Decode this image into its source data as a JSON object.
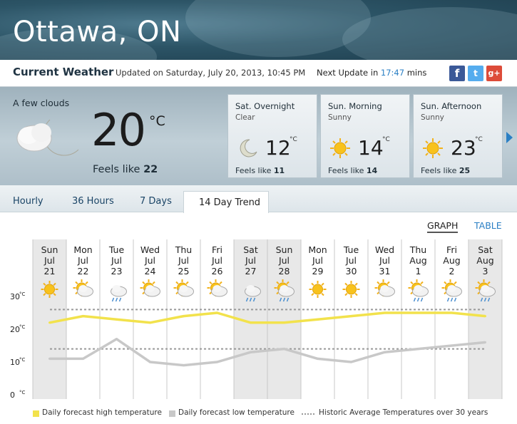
{
  "header": {
    "city": "Ottawa, ON"
  },
  "status": {
    "current_weather_label": "Current Weather",
    "updated": "Updated on Saturday, July 20, 2013, 10:45 PM",
    "next_update_prefix": "Next Update in",
    "next_update_value": "17:47",
    "next_update_suffix": "mins",
    "social": [
      {
        "name": "facebook-icon",
        "glyph": "f"
      },
      {
        "name": "twitter-icon",
        "glyph": "t"
      },
      {
        "name": "google-plus-icon",
        "glyph": "g+"
      }
    ]
  },
  "current": {
    "condition": "A few clouds",
    "temp": "20",
    "unit": "°C",
    "feels_prefix": "Feels like",
    "feels_value": "22",
    "icon": "cloud-moon-icon"
  },
  "forecast": [
    {
      "title": "Sat. Overnight",
      "desc": "Clear",
      "temp": "12",
      "unit": "°C",
      "feels_prefix": "Feels like",
      "feels": "11",
      "icon": "moon-icon"
    },
    {
      "title": "Sun. Morning",
      "desc": "Sunny",
      "temp": "14",
      "unit": "°C",
      "feels_prefix": "Feels like",
      "feels": "14",
      "icon": "sun-icon"
    },
    {
      "title": "Sun. Afternoon",
      "desc": "Sunny",
      "temp": "23",
      "unit": "°C",
      "feels_prefix": "Feels like",
      "feels": "25",
      "icon": "sun-icon"
    }
  ],
  "tabs": [
    "Hourly",
    "36 Hours",
    "7 Days",
    "14 Day Trend"
  ],
  "active_tab": "14 Day Trend",
  "view_toggle": {
    "graph": "GRAPH",
    "table": "TABLE",
    "active": "GRAPH"
  },
  "chart_data": {
    "type": "line",
    "x": [
      "Sun Jul 21",
      "Mon Jul 22",
      "Tue Jul 23",
      "Wed Jul 24",
      "Thu Jul 25",
      "Fri Jul 26",
      "Sat Jul 27",
      "Sun Jul 28",
      "Mon Jul 29",
      "Tue Jul 30",
      "Wed Jul 31",
      "Thu Aug 1",
      "Fri Aug 2",
      "Sat Aug 3"
    ],
    "days": [
      {
        "d": "Sun",
        "m": "Jul",
        "n": "21",
        "icon": "sun-icon",
        "weekend": true
      },
      {
        "d": "Mon",
        "m": "Jul",
        "n": "22",
        "icon": "sun-cloud-icon",
        "weekend": false
      },
      {
        "d": "Tue",
        "m": "Jul",
        "n": "23",
        "icon": "rain-cloud-icon",
        "weekend": false
      },
      {
        "d": "Wed",
        "m": "Jul",
        "n": "24",
        "icon": "sun-cloud-icon",
        "weekend": false
      },
      {
        "d": "Thu",
        "m": "Jul",
        "n": "25",
        "icon": "sun-cloud-icon",
        "weekend": false
      },
      {
        "d": "Fri",
        "m": "Jul",
        "n": "26",
        "icon": "sun-cloud-icon",
        "weekend": false
      },
      {
        "d": "Sat",
        "m": "Jul",
        "n": "27",
        "icon": "rain-cloud-icon",
        "weekend": true
      },
      {
        "d": "Sun",
        "m": "Jul",
        "n": "28",
        "icon": "sun-shower-icon",
        "weekend": true
      },
      {
        "d": "Mon",
        "m": "Jul",
        "n": "29",
        "icon": "sun-icon",
        "weekend": false
      },
      {
        "d": "Tue",
        "m": "Jul",
        "n": "30",
        "icon": "sun-icon",
        "weekend": false
      },
      {
        "d": "Wed",
        "m": "Jul",
        "n": "31",
        "icon": "sun-cloud-icon",
        "weekend": false
      },
      {
        "d": "Thu",
        "m": "Aug",
        "n": "1",
        "icon": "sun-shower-icon",
        "weekend": false
      },
      {
        "d": "Fri",
        "m": "Aug",
        "n": "2",
        "icon": "sun-shower-icon",
        "weekend": false
      },
      {
        "d": "Sat",
        "m": "Aug",
        "n": "3",
        "icon": "sun-shower-icon",
        "weekend": true
      }
    ],
    "series": [
      {
        "name": "Daily forecast high temperature",
        "color": "#f2e24c",
        "values": [
          22,
          24,
          23,
          22,
          24,
          25,
          22,
          22,
          23,
          24,
          25,
          25,
          25,
          24
        ]
      },
      {
        "name": "Daily forecast low temperature",
        "color": "#c8c8c8",
        "values": [
          11,
          11,
          17,
          10,
          9,
          10,
          13,
          14,
          11,
          10,
          13,
          14,
          15,
          16
        ]
      },
      {
        "name": "Historic Average Temperatures over 30 years",
        "color": "#999999",
        "dashed": true,
        "high": 26,
        "low": 14
      }
    ],
    "yticks": [
      "0",
      "10",
      "20",
      "30"
    ],
    "yunit": "°C",
    "ylim": [
      0,
      30
    ],
    "grid": true
  },
  "legend": [
    {
      "label": "Daily forecast high temperature",
      "color": "#f2e24c"
    },
    {
      "label": "Daily forecast low temperature",
      "color": "#c8c8c8"
    },
    {
      "label": "Historic Average Temperatures over 30 years",
      "color": "#999999",
      "dashed": true
    }
  ]
}
